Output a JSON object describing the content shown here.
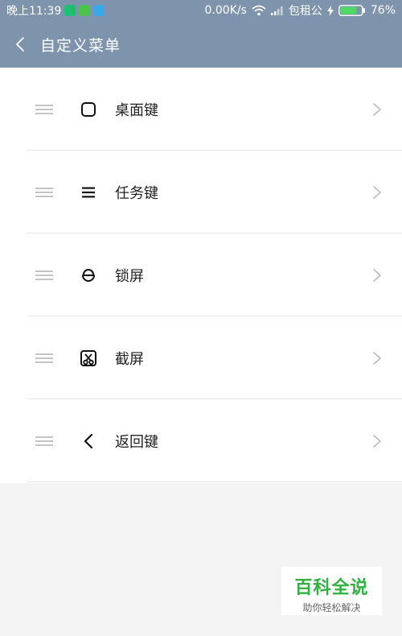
{
  "status_bar": {
    "time": "晚上11:39",
    "speed": "0.00K/s",
    "carrier": "包租公",
    "battery": "76%",
    "battery_level": 0.76
  },
  "header": {
    "title": "自定义菜单",
    "back_icon": "chevron-left-icon"
  },
  "menu_items": [
    {
      "label": "桌面键",
      "icon": "rounded-square-icon"
    },
    {
      "label": "任务键",
      "icon": "menu-lines-icon"
    },
    {
      "label": "锁屏",
      "icon": "lock-icon"
    },
    {
      "label": "截屏",
      "icon": "screenshot-scissors-icon"
    },
    {
      "label": "返回键",
      "icon": "back-arrow-icon"
    }
  ],
  "watermark": {
    "title": "百科全说",
    "subtitle": "助你轻松解决"
  },
  "colors": {
    "bar": "#7e93ac",
    "watermark_green": "#2fb23f"
  }
}
